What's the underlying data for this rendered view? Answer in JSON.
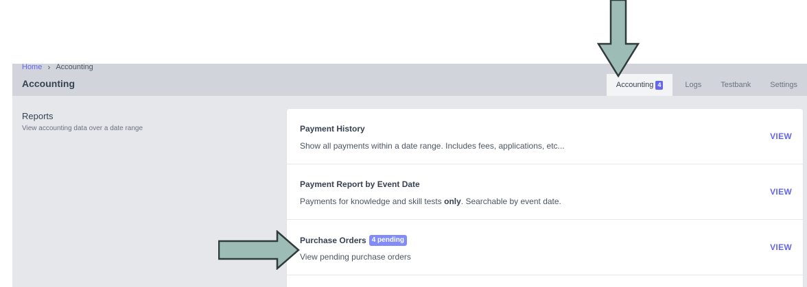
{
  "breadcrumb": {
    "home": "Home",
    "separator": "›",
    "current": "Accounting"
  },
  "page_title": "Accounting",
  "tabs": [
    {
      "label": "Accounting",
      "badge": "4",
      "active": true
    },
    {
      "label": "Logs"
    },
    {
      "label": "Testbank"
    },
    {
      "label": "Settings"
    }
  ],
  "section": {
    "title": "Reports",
    "description": "View accounting data over a date range"
  },
  "reports": [
    {
      "title": "Payment History",
      "description": "Show all payments within a date range. Includes fees, applications, etc...",
      "action": "VIEW"
    },
    {
      "title": "Payment Report by Event Date",
      "description_before": "Payments for knowledge and skill tests ",
      "description_bold": "only",
      "description_after": ". Searchable by event date.",
      "action": "VIEW"
    },
    {
      "title": "Purchase Orders",
      "badge": "4 pending",
      "description": "View pending purchase orders",
      "action": "VIEW"
    }
  ],
  "colors": {
    "accent": "#6366f1",
    "arrow_fill": "#9dbcb5",
    "arrow_stroke": "#2f3a3a",
    "header_bg": "#d1d5db",
    "page_bg": "#e5e7eb"
  }
}
